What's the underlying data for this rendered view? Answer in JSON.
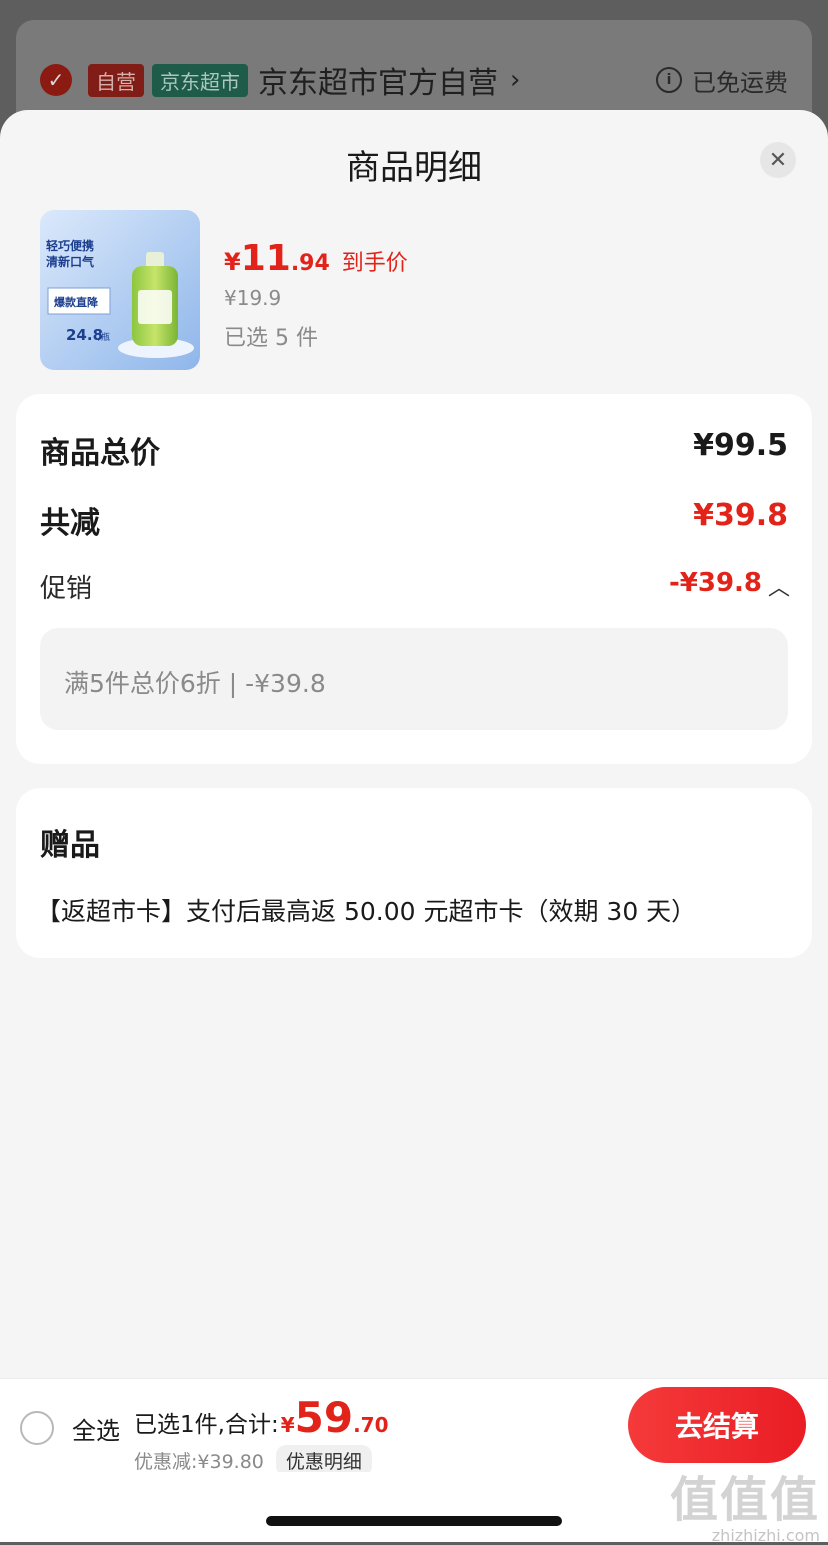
{
  "store": {
    "tag_ziying": "自营",
    "tag_jd": "京东超市",
    "name": "京东超市官方自营",
    "free_shipping": "已免运费",
    "chevron": "›"
  },
  "sheet": {
    "title": "商品明细",
    "close_symbol": "✕"
  },
  "product": {
    "price_yen": "¥",
    "price_int": "11",
    "price_dec": ".94",
    "price_tag": "到手价",
    "original_price": "¥19.9",
    "selected_count": "已选 5 件",
    "image_text": {
      "line1": "轻巧便携",
      "line2": "清新口气",
      "badge": "爆款直降",
      "price": "24.8",
      "unit": "/瓶"
    }
  },
  "summary": {
    "total_label": "商品总价",
    "total_value": "¥99.5",
    "reduced_label": "共减",
    "reduced_value": "¥39.8",
    "promo_label": "促销",
    "promo_value": "-¥39.8",
    "promo_detail": "满5件总价6折 | -¥39.8"
  },
  "gift": {
    "title": "赠品",
    "text": "【返超市卡】支付后最高返 50.00 元超市卡（效期 30 天）"
  },
  "bottom": {
    "select_all": "全选",
    "total_text": "已选1件,合计:",
    "total_yen": "¥",
    "total_int": "59",
    "total_dec": ".70",
    "discount_text": "优惠减:¥39.80",
    "discount_detail": "优惠明细",
    "checkout": "去结算"
  },
  "watermark": {
    "big": "值值值",
    "small": "zhizhizhi.com"
  },
  "colors": {
    "accent_red": "#e2231a",
    "checkout_gradient_start": "#f53a3a",
    "checkout_gradient_end": "#e91d24"
  }
}
